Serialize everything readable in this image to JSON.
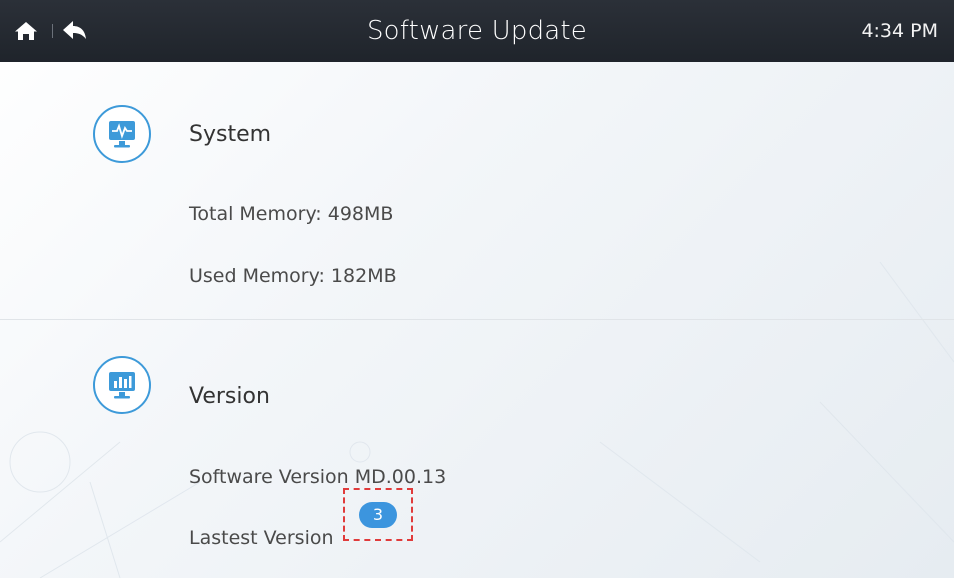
{
  "header": {
    "title": "Software Update",
    "time": "4:34 PM",
    "home_icon": "home-icon",
    "back_icon": "back-arrow-icon"
  },
  "system": {
    "title": "System",
    "icon": "monitor-pulse-icon",
    "total_memory": "Total Memory:   498MB",
    "used_memory": "Used Memory:   182MB"
  },
  "version": {
    "title": "Version",
    "icon": "monitor-chart-icon",
    "software_version": "Software Version    MD.00.13",
    "latest_version": "Lastest Version",
    "badge": "3"
  },
  "colors": {
    "topbar": "#23282f",
    "accent": "#3d9ad9",
    "badge": "#3c95de",
    "annotation": "#e03b3b"
  }
}
